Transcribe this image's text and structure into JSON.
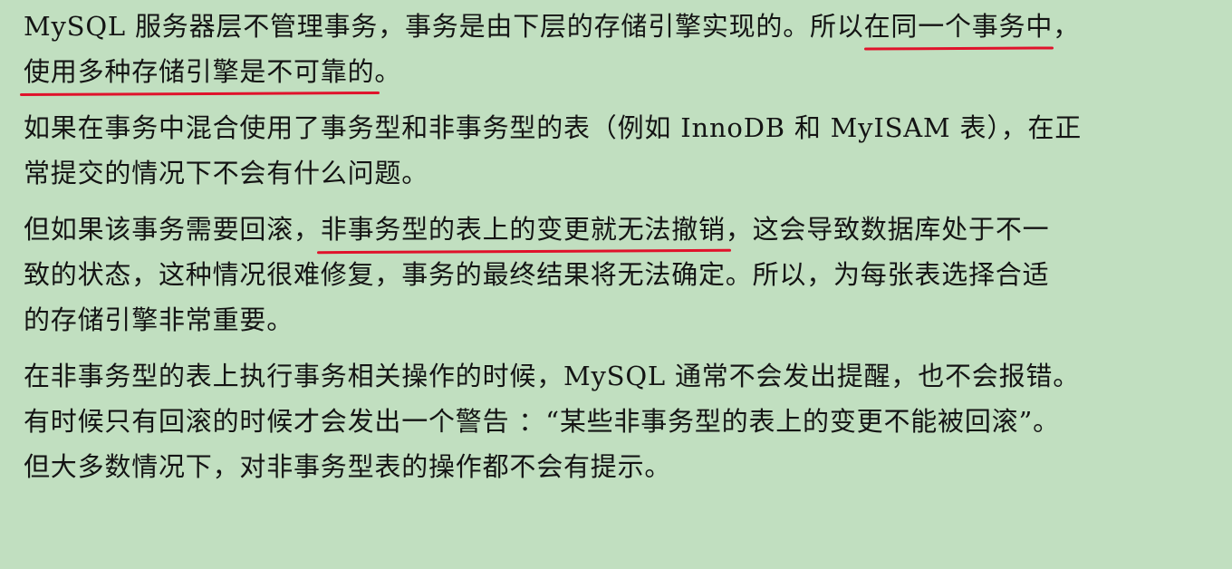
{
  "paragraphs": [
    {
      "l1a": "MySQL 服务器层不管理事务，事务是由下层的存储引擎实现的。所以",
      "l1u": "在同一个事务中",
      "l1b": "，",
      "l2u": "使用多种存储引擎是不可靠的",
      "l2b": "。"
    },
    {
      "l1": "如果在事务中混合使用了事务型和非事务型的表（例如 InnoDB 和 MyISAM 表），在正",
      "l2": "常提交的情况下不会有什么问题。"
    },
    {
      "l1a": "但如果该事务需要回滚，",
      "l1u": "非事务型的表上的变更就无法撤销",
      "l1b": "，这会导致数据库处于不一",
      "l2": "致的状态，这种情况很难修复，事务的最终结果将无法确定。所以，为每张表选择合适",
      "l3": "的存储引擎非常重要。"
    },
    {
      "l1": "在非事务型的表上执行事务相关操作的时候，MySQL 通常不会发出提醒，也不会报错。",
      "l2": "有时候只有回滚的时候才会发出一个警告 ：“某些非事务型的表上的变更不能被回滚”。",
      "l3": "但大多数情况下，对非事务型表的操作都不会有提示。"
    }
  ]
}
